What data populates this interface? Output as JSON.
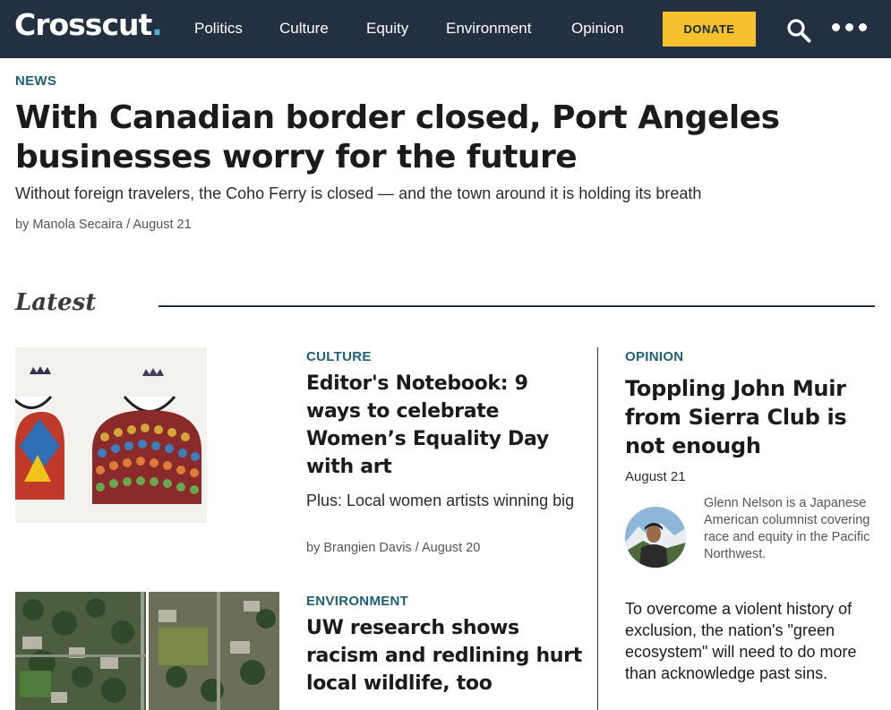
{
  "nav": {
    "logo_text": "Crosscut",
    "logo_dot": ".",
    "links": [
      "Politics",
      "Culture",
      "Equity",
      "Environment",
      "Opinion"
    ],
    "donate_label": "DONATE"
  },
  "hero": {
    "kicker": "NEWS",
    "title": "With Canadian border closed, Port Angeles businesses worry for the future",
    "dek": "Without foreign travelers, the Coho Ferry is closed — and the town around it is holding its breath",
    "byline": "by Manola Secaira / August 21"
  },
  "latest": {
    "heading": "Latest",
    "stories": [
      {
        "kicker": "CULTURE",
        "title": "Editor's Notebook: 9 ways to celebrate Women’s Equality Day with art",
        "dek": "Plus: Local women artists winning big",
        "byline": "by Brangien Davis / August 20"
      },
      {
        "kicker": "ENVIRONMENT",
        "title": "UW research shows racism and redlining hurt local wildlife, too"
      }
    ],
    "opinion": {
      "kicker": "OPINION",
      "title": "Toppling John Muir from Sierra Club is not enough",
      "date": "August 21",
      "bio": "Glenn Nelson is a Japanese American columnist covering race and equity in the Pacific Northwest.",
      "dek": "To overcome a violent history of exclusion, the nation's \"green ecosystem\" will need to do more than acknowledge past sins."
    }
  },
  "colors": {
    "nav_bg": "#223041",
    "kicker": "#1f6079",
    "donate_bg": "#f6c12c",
    "logo_dot": "#4fb0d6"
  }
}
